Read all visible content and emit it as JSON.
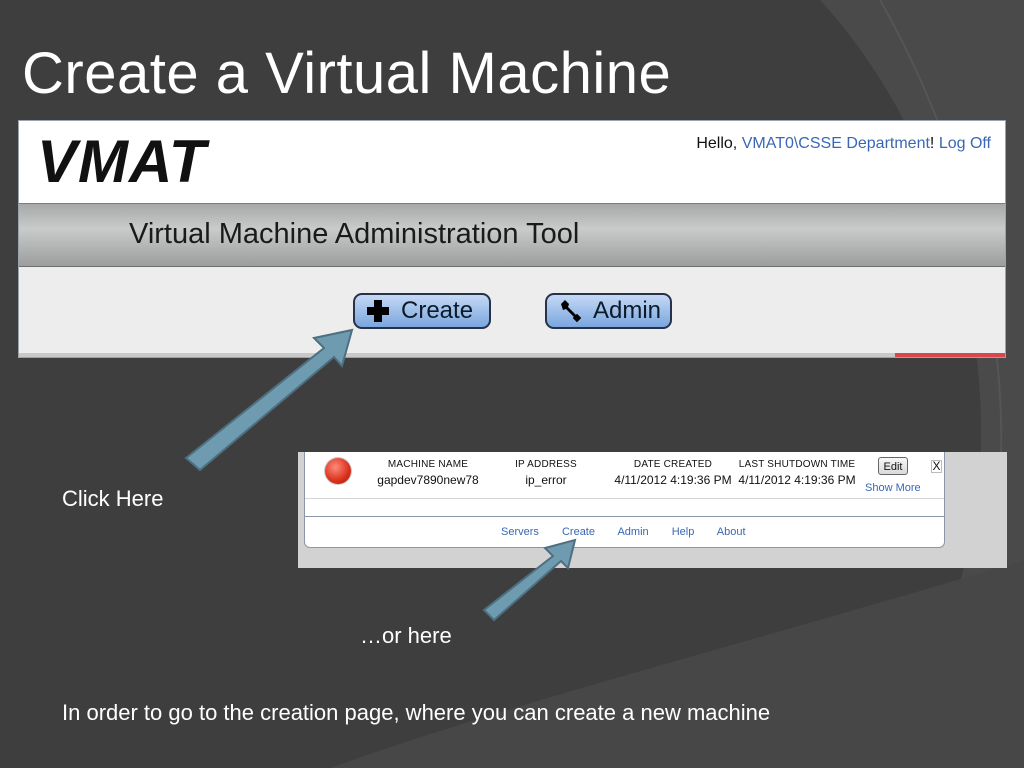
{
  "slide": {
    "title": "Create a Virtual Machine",
    "captions": {
      "click_here": "Click Here",
      "or_here": "…or here",
      "explanation": "In order to go to the creation page, where you can create a new machine"
    }
  },
  "vmat_header": {
    "logo": "VMAT",
    "hello_prefix": "Hello, ",
    "user": "VMAT0\\CSSE Department",
    "exclaim": "! ",
    "logoff": "Log Off",
    "tool_title": "Virtual Machine Administration Tool",
    "buttons": {
      "create_label": "Create",
      "admin_label": "Admin"
    }
  },
  "machine_list": {
    "columns": {
      "name": "MACHINE NAME",
      "ip": "IP ADDRESS",
      "date_created": "DATE CREATED",
      "last_shutdown": "LAST SHUTDOWN TIME"
    },
    "row": {
      "name": "gapdev7890new78",
      "ip": "ip_error",
      "date_created": "4/11/2012 4:19:36 PM",
      "last_shutdown": "4/11/2012 4:19:36 PM",
      "status_color": "#d9301c"
    },
    "edit_label": "Edit",
    "close_label": "X",
    "show_more": "Show More",
    "footer_links": {
      "servers": "Servers",
      "create": "Create",
      "admin": "Admin",
      "help": "Help",
      "about": "About"
    }
  },
  "icons": {
    "create": "plus-icon",
    "admin": "wrench-icon"
  },
  "colors": {
    "background": "#3e3e3e",
    "link": "#3a67b5",
    "arrow": "#6f9bb0"
  }
}
